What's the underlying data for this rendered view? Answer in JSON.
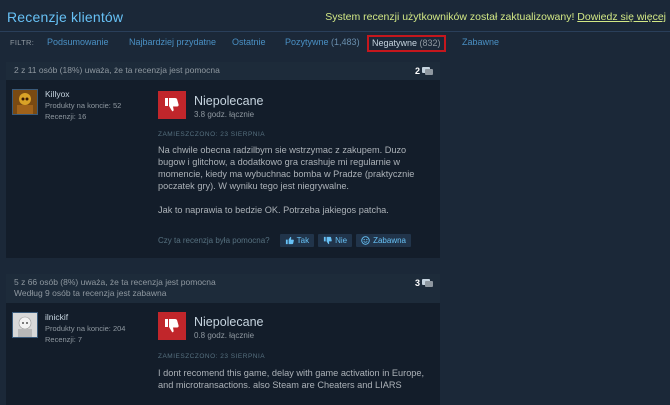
{
  "header": {
    "title": "Recenzje klientów",
    "notice_text": "System recenzji użytkowników został zaktualizowany!",
    "notice_link": "Dowiedz się więcej"
  },
  "filter": {
    "label": "FILTR:",
    "tabs": [
      {
        "label": "Podsumowanie",
        "count": ""
      },
      {
        "label": "Najbardziej przydatne",
        "count": ""
      },
      {
        "label": "Ostatnie",
        "count": ""
      },
      {
        "label": "Pozytywne",
        "count": "(1,483)"
      },
      {
        "label": "Negatywne",
        "count": "(832)"
      },
      {
        "label": "Zabawne",
        "count": ""
      }
    ],
    "active_tab": "Negatywne"
  },
  "reviews": [
    {
      "helpful_line": "2 z 11 osób (18%) uważa, że ta recenzja jest pomocna",
      "funny_line": "",
      "comments": "2",
      "author": {
        "name": "Killyox",
        "products": "Produkty na koncie: 52",
        "reviews": "Recenzji: 16"
      },
      "verdict": "Niepolecane",
      "hours": "3.8 godz. łącznie",
      "posted": "ZAMIESZCZONO: 23 SIERPNIA",
      "paragraphs": [
        "Na chwile obecna radzilbym sie wstrzymac z zakupem. Duzo bugow i glitchow, a dodatkowo gra crashuje mi regularnie w momencie, kiedy ma wybuchnac bomba w Pradze (praktycznie poczatek gry). W wyniku tego jest niegrywalne.",
        "Jak to naprawia to bedzie OK. Potrzeba jakiegos patcha."
      ],
      "helpful_question": "Czy ta recenzja była pomocna?",
      "buttons": {
        "yes": "Tak",
        "no": "Nie",
        "funny": "Zabawna"
      }
    },
    {
      "helpful_line": "5 z 66 osób (8%) uważa, że ta recenzja jest pomocna",
      "funny_line": "Według 9 osób ta recenzja jest zabawna",
      "comments": "3",
      "author": {
        "name": "ilnickif",
        "products": "Produkty na koncie: 204",
        "reviews": "Recenzji: 7"
      },
      "verdict": "Niepolecane",
      "hours": "0.8 godz. łącznie",
      "posted": "ZAMIESZCZONO: 23 SIERPNIA",
      "paragraphs": [
        "I dont recomend this game, delay with game activation in Europe, and microtransactions. also Steam are Cheaters and LIARS"
      ]
    }
  ],
  "colors": {
    "background": "#1b2838",
    "accent_blue": "#67c1f5",
    "notice_green": "#d2e885",
    "thumb_red": "#c1262b",
    "active_outline": "#c5171d"
  }
}
